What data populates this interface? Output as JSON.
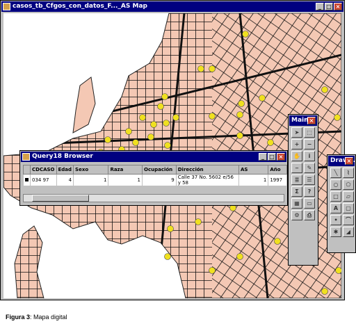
{
  "map_window": {
    "title": "casos_tb_Cfgos_con_datos_F..._AS Map",
    "map": {
      "land_color": "#f4c8b4",
      "water_color": "#ffffff",
      "street_color": "#101010",
      "case_marker_color": "#f0e020"
    }
  },
  "query_window": {
    "title": "Query18 Browser",
    "columns": [
      "CDCASO",
      "Edad",
      "Sexo",
      "Raza",
      "Ocupación",
      "Dirección",
      "AS",
      "Año"
    ],
    "row": [
      "034 97",
      "4",
      "1",
      "1",
      "9",
      "Calle 37 No. 5602 e/56 y 58",
      "1",
      "1997"
    ]
  },
  "main_window": {
    "title": "Main",
    "tools": [
      "arrow-icon",
      "select-icon",
      "zoom-in-icon",
      "zoom-out-icon",
      "hand-icon",
      "info-icon",
      "ruler-icon",
      "label-icon",
      "layer-icon",
      "legend-icon",
      "sigma-icon",
      "query-icon",
      "grid-icon",
      "window-icon",
      "settings-icon",
      "print-icon"
    ]
  },
  "draw_window": {
    "title": "Drawi...",
    "tools": [
      "line-icon",
      "polyline-icon",
      "circle-icon",
      "polygon-icon",
      "rectangle-icon",
      "region-icon",
      "text-icon",
      "frame-icon",
      "point-icon",
      "arc-icon",
      "symbol-icon",
      "style-icon"
    ]
  },
  "caption": {
    "label": "Figura 3",
    "text": ": Mapa digital"
  }
}
